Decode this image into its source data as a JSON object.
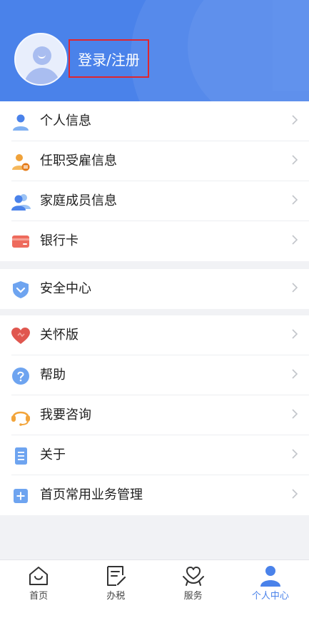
{
  "header": {
    "login_label": "登录/注册"
  },
  "menu_group_1": [
    {
      "label": "个人信息",
      "icon": "person-icon"
    },
    {
      "label": "任职受雇信息",
      "icon": "employment-icon"
    },
    {
      "label": "家庭成员信息",
      "icon": "family-icon"
    },
    {
      "label": "银行卡",
      "icon": "bank-card-icon"
    }
  ],
  "menu_group_2": [
    {
      "label": "安全中心",
      "icon": "shield-icon"
    }
  ],
  "menu_group_3": [
    {
      "label": "关怀版",
      "icon": "heart-icon"
    },
    {
      "label": "帮助",
      "icon": "question-icon"
    },
    {
      "label": "我要咨询",
      "icon": "headset-icon"
    },
    {
      "label": "关于",
      "icon": "document-icon"
    },
    {
      "label": "首页常用业务管理",
      "icon": "plus-square-icon"
    }
  ],
  "tabbar": [
    {
      "label": "首页",
      "icon": "home-icon",
      "active": false
    },
    {
      "label": "办税",
      "icon": "edit-icon",
      "active": false
    },
    {
      "label": "服务",
      "icon": "service-heart-icon",
      "active": false
    },
    {
      "label": "个人中心",
      "icon": "user-icon",
      "active": true
    }
  ],
  "colors": {
    "primary": "#4a82ea",
    "highlight_border": "#e0262e"
  }
}
